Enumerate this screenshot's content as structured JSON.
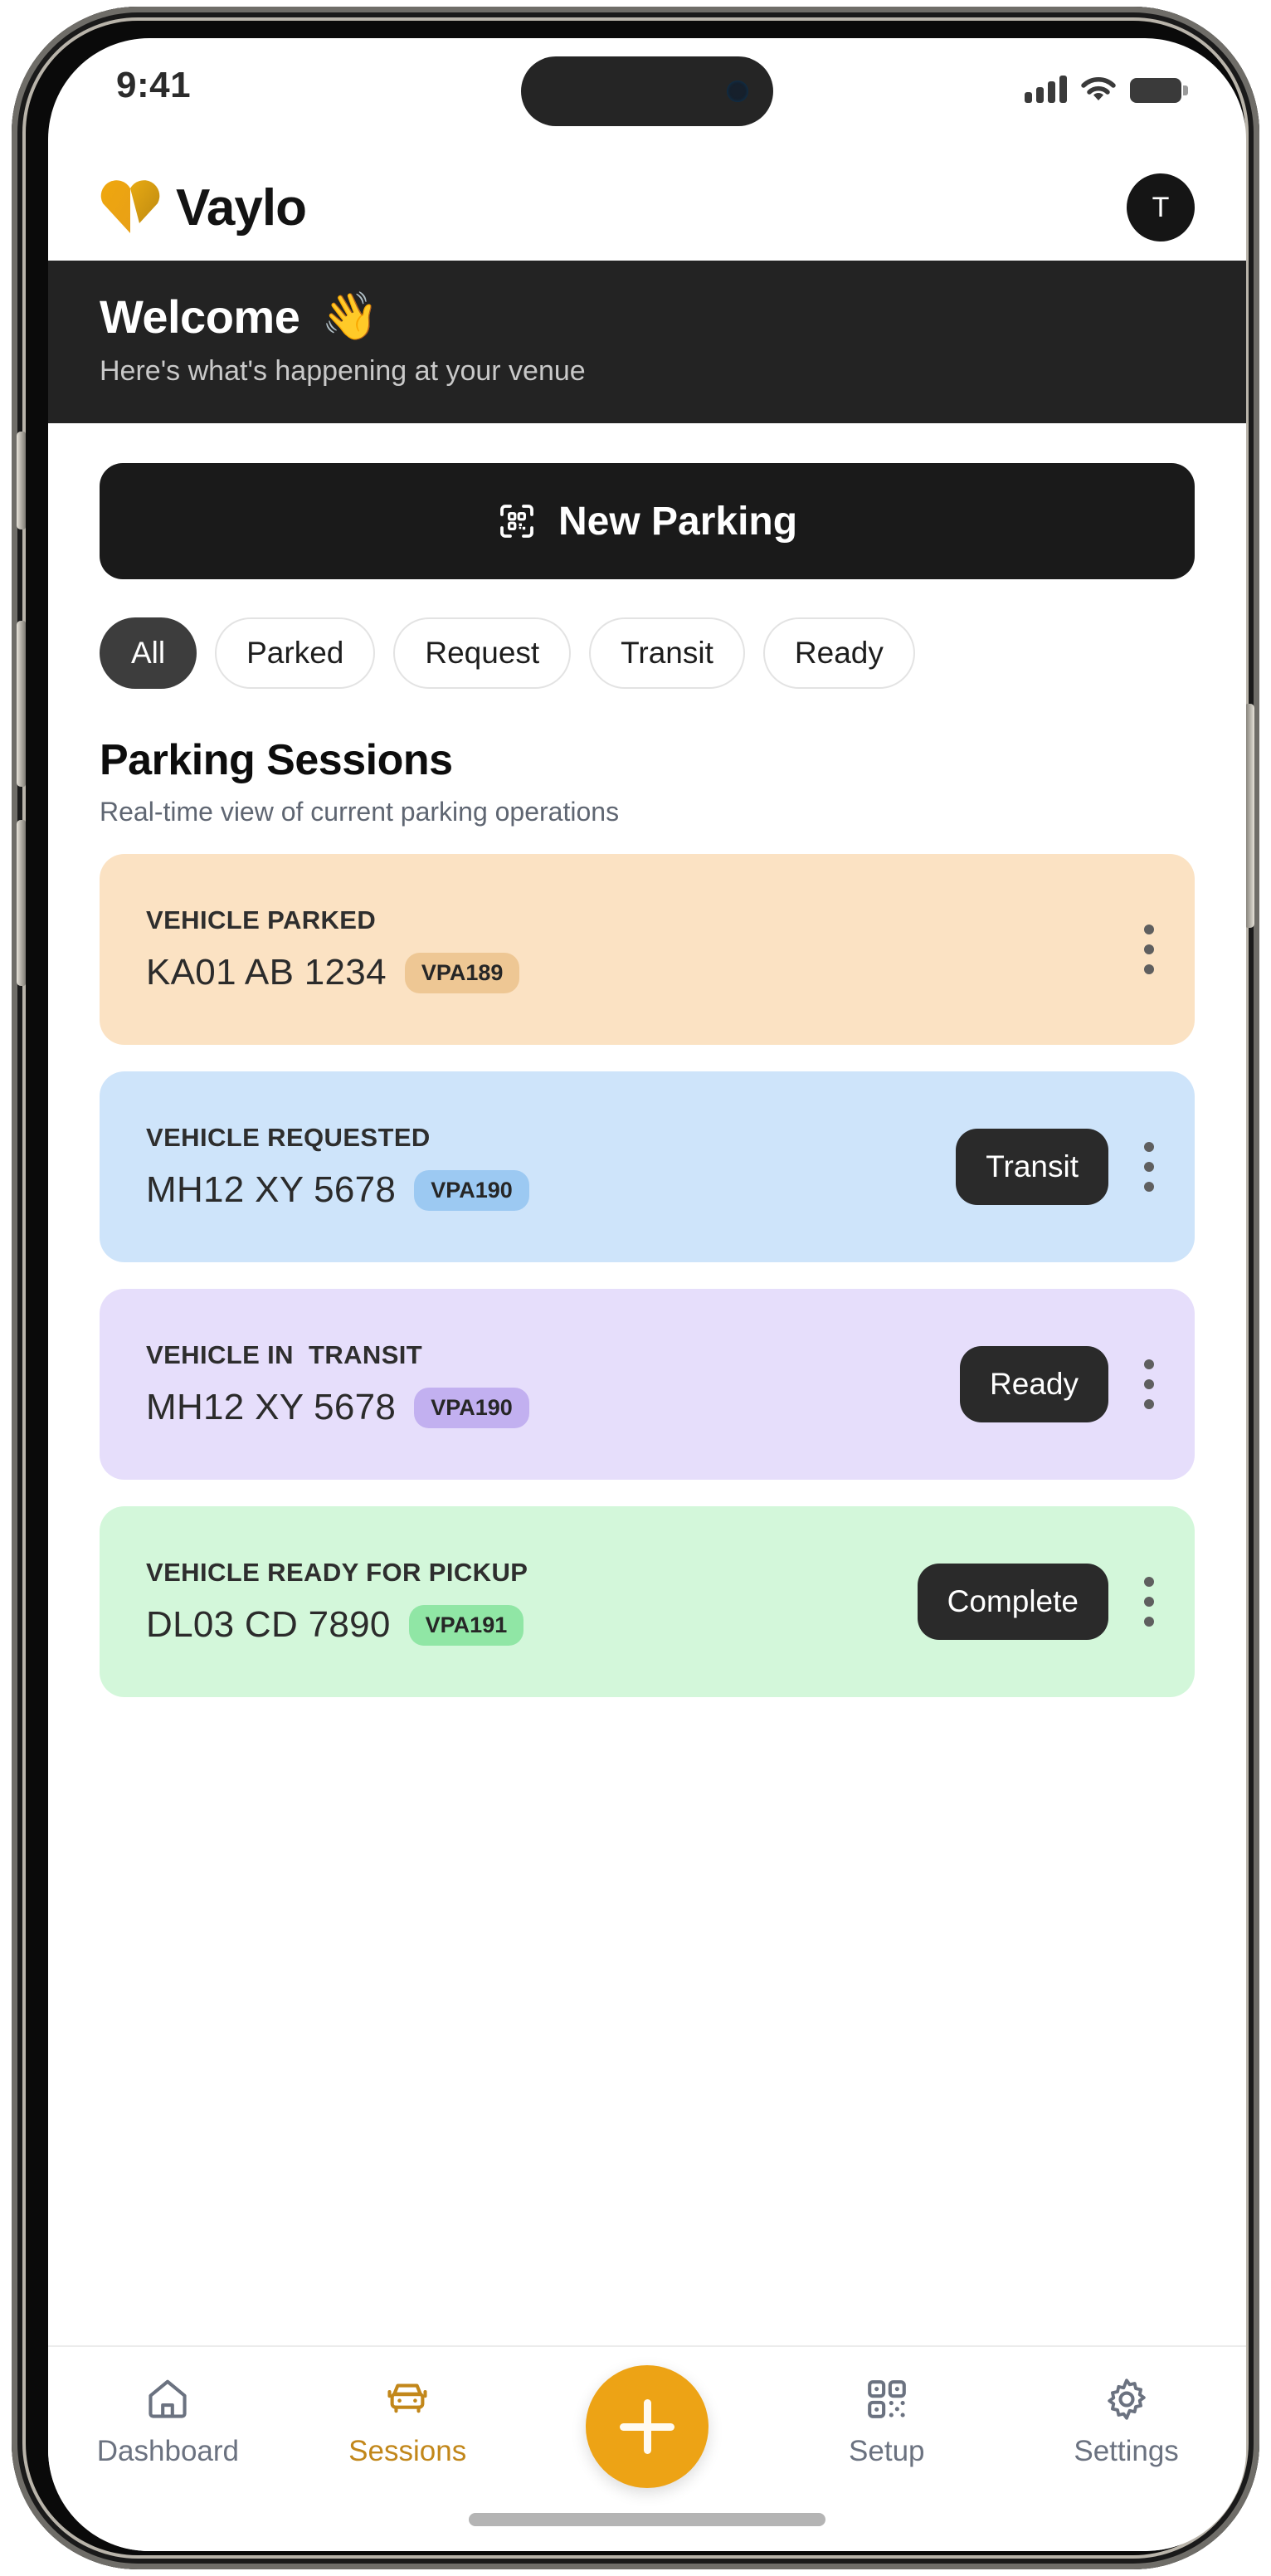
{
  "status_bar": {
    "time": "9:41",
    "signal_icon": "cellular-signal-icon",
    "wifi_icon": "wifi-icon",
    "battery_icon": "battery-icon"
  },
  "header": {
    "brand_name": "Vaylo",
    "logo_icon": "heart-logo-icon",
    "logo_color": "#EFA70E",
    "avatar_initial": "T"
  },
  "welcome": {
    "title": "Welcome",
    "emoji": "👋",
    "subtitle": "Here's what's happening at your venue"
  },
  "primary_action": {
    "label": "New Parking",
    "icon": "qr-scan-icon"
  },
  "filters": [
    {
      "label": "All",
      "active": true
    },
    {
      "label": "Parked",
      "active": false
    },
    {
      "label": "Request",
      "active": false
    },
    {
      "label": "Transit",
      "active": false
    },
    {
      "label": "Ready",
      "active": false
    }
  ],
  "sessions_section": {
    "title": "Parking Sessions",
    "subtitle": "Real-time view of current parking operations"
  },
  "sessions": [
    {
      "status": "VEHICLE PARKED",
      "plate": "KA01 AB 1234",
      "badge": "VPA189",
      "action": "",
      "bg": "#FBE2C3",
      "badge_bg": "#EEC794"
    },
    {
      "status": "VEHICLE REQUESTED",
      "plate": "MH12 XY 5678",
      "badge": "VPA190",
      "action": "Transit",
      "bg": "#CEE4FA",
      "badge_bg": "#9CC9F2"
    },
    {
      "status": "VEHICLE IN  TRANSIT",
      "plate": "MH12 XY 5678",
      "badge": "VPA190",
      "action": "Ready",
      "bg": "#E6DEFB",
      "badge_bg": "#C2B0F0"
    },
    {
      "status": "VEHICLE READY FOR PICKUP",
      "plate": "DL03 CD 7890",
      "badge": "VPA191",
      "action": "Complete",
      "bg": "#D3F7DA",
      "badge_bg": "#90E6A5"
    }
  ],
  "tabbar": {
    "items": [
      {
        "label": "Dashboard",
        "icon": "home-icon",
        "active": false
      },
      {
        "label": "Sessions",
        "icon": "car-icon",
        "active": true
      },
      {
        "label": "Setup",
        "icon": "qr-code-icon",
        "active": false
      },
      {
        "label": "Settings",
        "icon": "gear-icon",
        "active": false
      }
    ],
    "fab_icon": "plus-icon",
    "fab_color": "#EDA315",
    "active_color": "#C2871A",
    "inactive_color": "#6B7280"
  }
}
